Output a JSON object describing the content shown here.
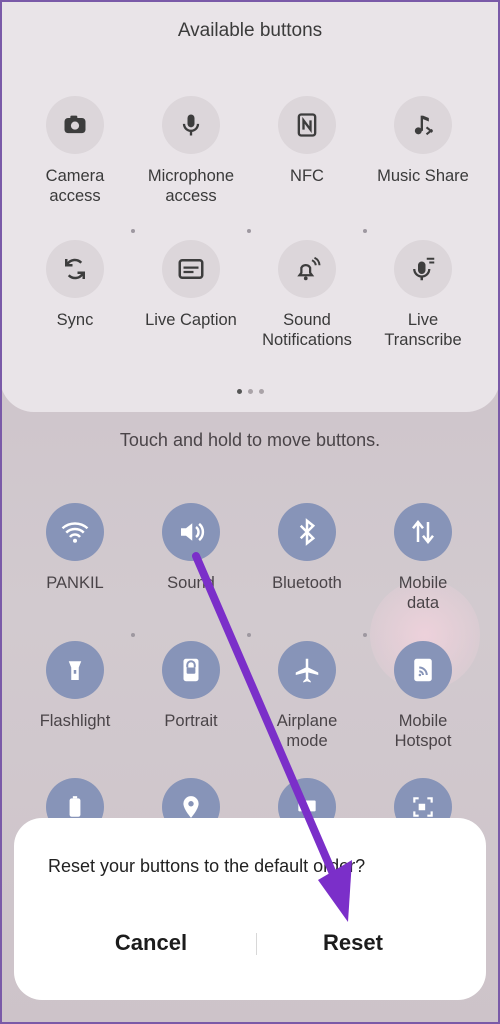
{
  "available": {
    "title": "Available buttons",
    "tiles": [
      {
        "label": "Camera\naccess",
        "icon": "camera-icon"
      },
      {
        "label": "Microphone\naccess",
        "icon": "microphone-icon"
      },
      {
        "label": "NFC",
        "icon": "nfc-icon"
      },
      {
        "label": "Music Share",
        "icon": "music-share-icon"
      },
      {
        "label": "Sync",
        "icon": "sync-icon"
      },
      {
        "label": "Live Caption",
        "icon": "live-caption-icon"
      },
      {
        "label": "Sound\nNotifications",
        "icon": "sound-notifications-icon"
      },
      {
        "label": "Live\nTranscribe",
        "icon": "live-transcribe-icon"
      }
    ]
  },
  "hint": "Touch and hold to move buttons.",
  "active": {
    "tiles": [
      {
        "label": "PANKIL",
        "icon": "wifi-icon"
      },
      {
        "label": "Sound",
        "icon": "sound-icon"
      },
      {
        "label": "Bluetooth",
        "icon": "bluetooth-icon"
      },
      {
        "label": "Mobile\ndata",
        "icon": "mobile-data-icon"
      },
      {
        "label": "Flashlight",
        "icon": "flashlight-icon"
      },
      {
        "label": "Portrait",
        "icon": "portrait-icon"
      },
      {
        "label": "Airplane\nmode",
        "icon": "airplane-icon"
      },
      {
        "label": "Mobile\nHotspot",
        "icon": "hotspot-icon"
      }
    ]
  },
  "dialog": {
    "message": "Reset your buttons to the default order?",
    "cancel": "Cancel",
    "reset": "Reset"
  },
  "colors": {
    "arrow": "#7b2fc9",
    "tile_active": "#8794b8"
  }
}
